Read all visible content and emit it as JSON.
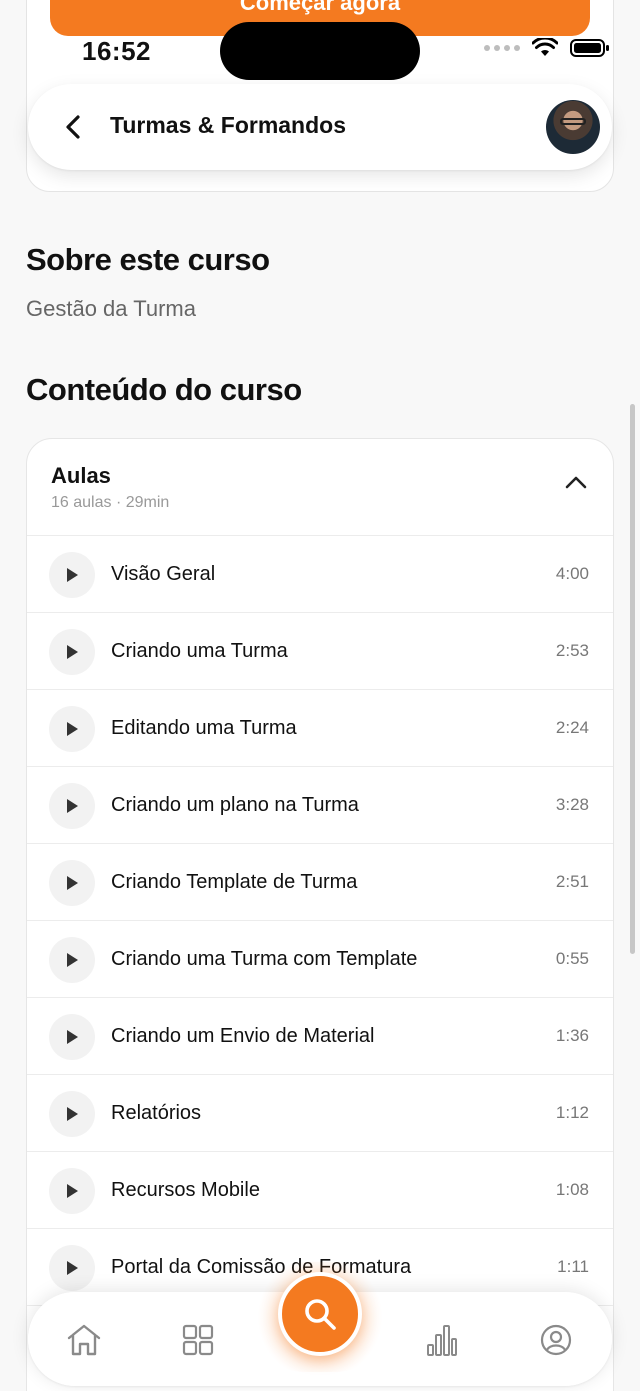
{
  "cta": {
    "label": "Começar agora"
  },
  "status_bar": {
    "time": "16:52"
  },
  "header": {
    "title": "Turmas & Formandos"
  },
  "about": {
    "heading": "Sobre este curso",
    "text": "Gestão da Turma"
  },
  "content": {
    "heading": "Conteúdo do curso"
  },
  "lessons_card": {
    "title": "Aulas",
    "subtitle": "16 aulas · 29min",
    "items": [
      {
        "title": "Visão Geral",
        "duration": "4:00"
      },
      {
        "title": "Criando uma Turma",
        "duration": "2:53"
      },
      {
        "title": "Editando uma Turma",
        "duration": "2:24"
      },
      {
        "title": "Criando um plano na Turma",
        "duration": "3:28"
      },
      {
        "title": "Criando Template de Turma",
        "duration": "2:51"
      },
      {
        "title": "Criando uma Turma com Template",
        "duration": "0:55"
      },
      {
        "title": "Criando um Envio de Material",
        "duration": "1:36"
      },
      {
        "title": "Relatórios",
        "duration": "1:12"
      },
      {
        "title": "Recursos Mobile",
        "duration": "1:08"
      },
      {
        "title": "Portal da Comissão de Formatura",
        "duration": "1:11"
      }
    ]
  },
  "tabbar": {
    "items": [
      "home-icon",
      "grid-icon",
      "search-icon",
      "chart-icon",
      "profile-icon"
    ]
  },
  "colors": {
    "accent": "#f47a20",
    "background": "#f8f8f8"
  }
}
